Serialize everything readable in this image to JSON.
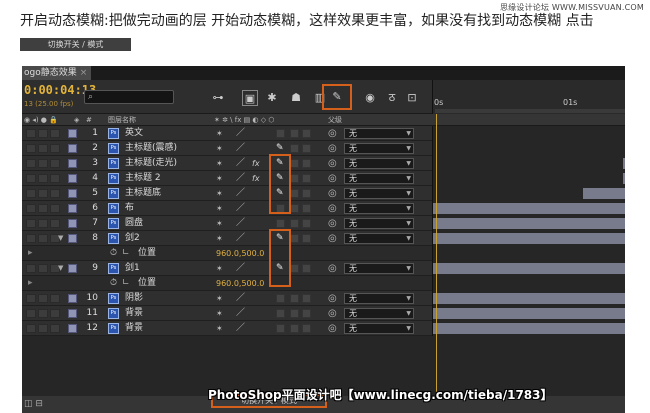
{
  "watermark": "思缘设计论坛 WWW.MISSVUAN.COM",
  "caption": "开启动态模糊:把做完动画的层 开始动态模糊，这样效果更丰富，如果没有找到动态模糊 点击",
  "tag_button": "切换开关 / 模式",
  "banner": "PhotoShop平面设计吧【www.linecg.com/tieba/1783】",
  "timeline": {
    "tab": "ogo静态效果",
    "tab_close": "×",
    "timecode": "0:00:04:13",
    "fps": "13 (25.00 fps)",
    "ruler": [
      "0s",
      "01s"
    ],
    "cols": {
      "num": "#",
      "name": "图层名称",
      "parent": "父级"
    },
    "toggle": "切换开关 / 模式",
    "layers": [
      {
        "num": "1",
        "name": "英文",
        "fx": false,
        "mb": false,
        "parent": "无",
        "clip": [
          192,
          193
        ]
      },
      {
        "num": "2",
        "name": "主标题(震感)",
        "fx": false,
        "mb": true,
        "parent": "无",
        "clip": [
          192,
          193
        ]
      },
      {
        "num": "3",
        "name": "主标题(走光)",
        "fx": true,
        "mb": true,
        "parent": "无",
        "clip": [
          190,
          193
        ]
      },
      {
        "num": "4",
        "name": "主标题 2",
        "fx": true,
        "mb": true,
        "parent": "无",
        "clip": [
          190,
          193
        ]
      },
      {
        "num": "5",
        "name": "主标题底",
        "fx": false,
        "mb": true,
        "parent": "无",
        "clip": [
          150,
          193
        ]
      },
      {
        "num": "6",
        "name": "布",
        "fx": false,
        "mb": false,
        "parent": "无",
        "clip": [
          0,
          193
        ]
      },
      {
        "num": "7",
        "name": "圆盘",
        "fx": false,
        "mb": false,
        "parent": "无",
        "clip": [
          0,
          193
        ]
      },
      {
        "num": "8",
        "name": "剑2",
        "fx": false,
        "mb": true,
        "parent": "无",
        "clip": [
          0,
          193
        ],
        "expanded": true
      },
      {
        "sub": true,
        "name": "位置",
        "value": "960.0,500.0"
      },
      {
        "num": "9",
        "name": "剑1",
        "fx": false,
        "mb": true,
        "parent": "无",
        "clip": [
          0,
          193
        ],
        "expanded": true
      },
      {
        "sub": true,
        "name": "位置",
        "value": "960.0,500.0"
      },
      {
        "num": "10",
        "name": "阴影",
        "fx": false,
        "mb": false,
        "parent": "无",
        "clip": [
          0,
          193
        ]
      },
      {
        "num": "11",
        "name": "背景",
        "fx": false,
        "mb": false,
        "parent": "无",
        "clip": [
          0,
          193
        ]
      },
      {
        "num": "12",
        "name": "背景",
        "fx": false,
        "mb": false,
        "parent": "无",
        "clip": [
          0,
          193
        ]
      }
    ]
  }
}
